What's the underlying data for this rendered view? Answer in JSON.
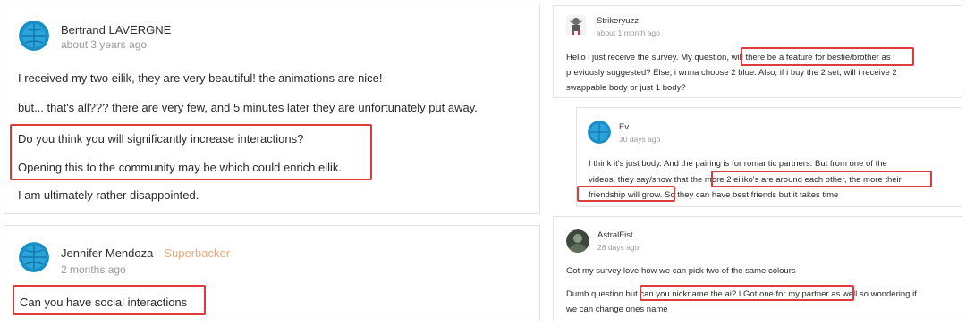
{
  "comments": [
    {
      "author": "Bertrand LAVERGNE",
      "time": "about 3 years ago",
      "avatar": "avatar-globe-icon",
      "paragraphs": [
        "I received my two eilik, they are very beautiful! the animations are nice!",
        "but... that's all??? there are very few, and 5 minutes later they are unfortunately put away.",
        "Do you think you will significantly increase interactions?",
        "Opening this to the community may be which could enrich eilik.",
        "I am ultimately rather disappointed."
      ]
    },
    {
      "author": "Jennifer Mendoza",
      "badge": "Superbacker",
      "time": "2 months ago",
      "avatar": "avatar-globe-icon",
      "paragraphs": [
        "Can you have social interactions"
      ]
    },
    {
      "author": "Strikeryuzz",
      "time": "about 1 month ago",
      "avatar": "avatar-character-icon",
      "lines": [
        "Hello i just receive the survey. My question, will there be a feature for bestie/brother as i",
        "previously suggested? Else, i wnna choose 2 blue. Also, if i buy the 2 set, will i receive 2",
        "swappable body or just 1 body?"
      ]
    },
    {
      "author": "Ev",
      "time": "30 days ago",
      "avatar": "avatar-globe-icon",
      "lines": [
        "I think it's just body. And the pairing is for romantic partners. But from one of the",
        "videos, they say/show that the more 2 eiliko's are around each other, the more their",
        "friendship will grow. So they can have best friends but it takes time"
      ]
    },
    {
      "author": "AstralFist",
      "time": "28 days ago",
      "avatar": "avatar-photo-icon",
      "lines": [
        "Got my survey love how we can pick two of the same colours",
        "Dumb question but can you nickname the ai? I Got one for my partner as well so wondering if",
        "we can change ones name"
      ]
    }
  ],
  "colors": {
    "highlight": "#e03b3b",
    "badge": "#f0a877",
    "avatar_globe": "#1a8fc7",
    "meta_text": "#9a9a9a"
  }
}
